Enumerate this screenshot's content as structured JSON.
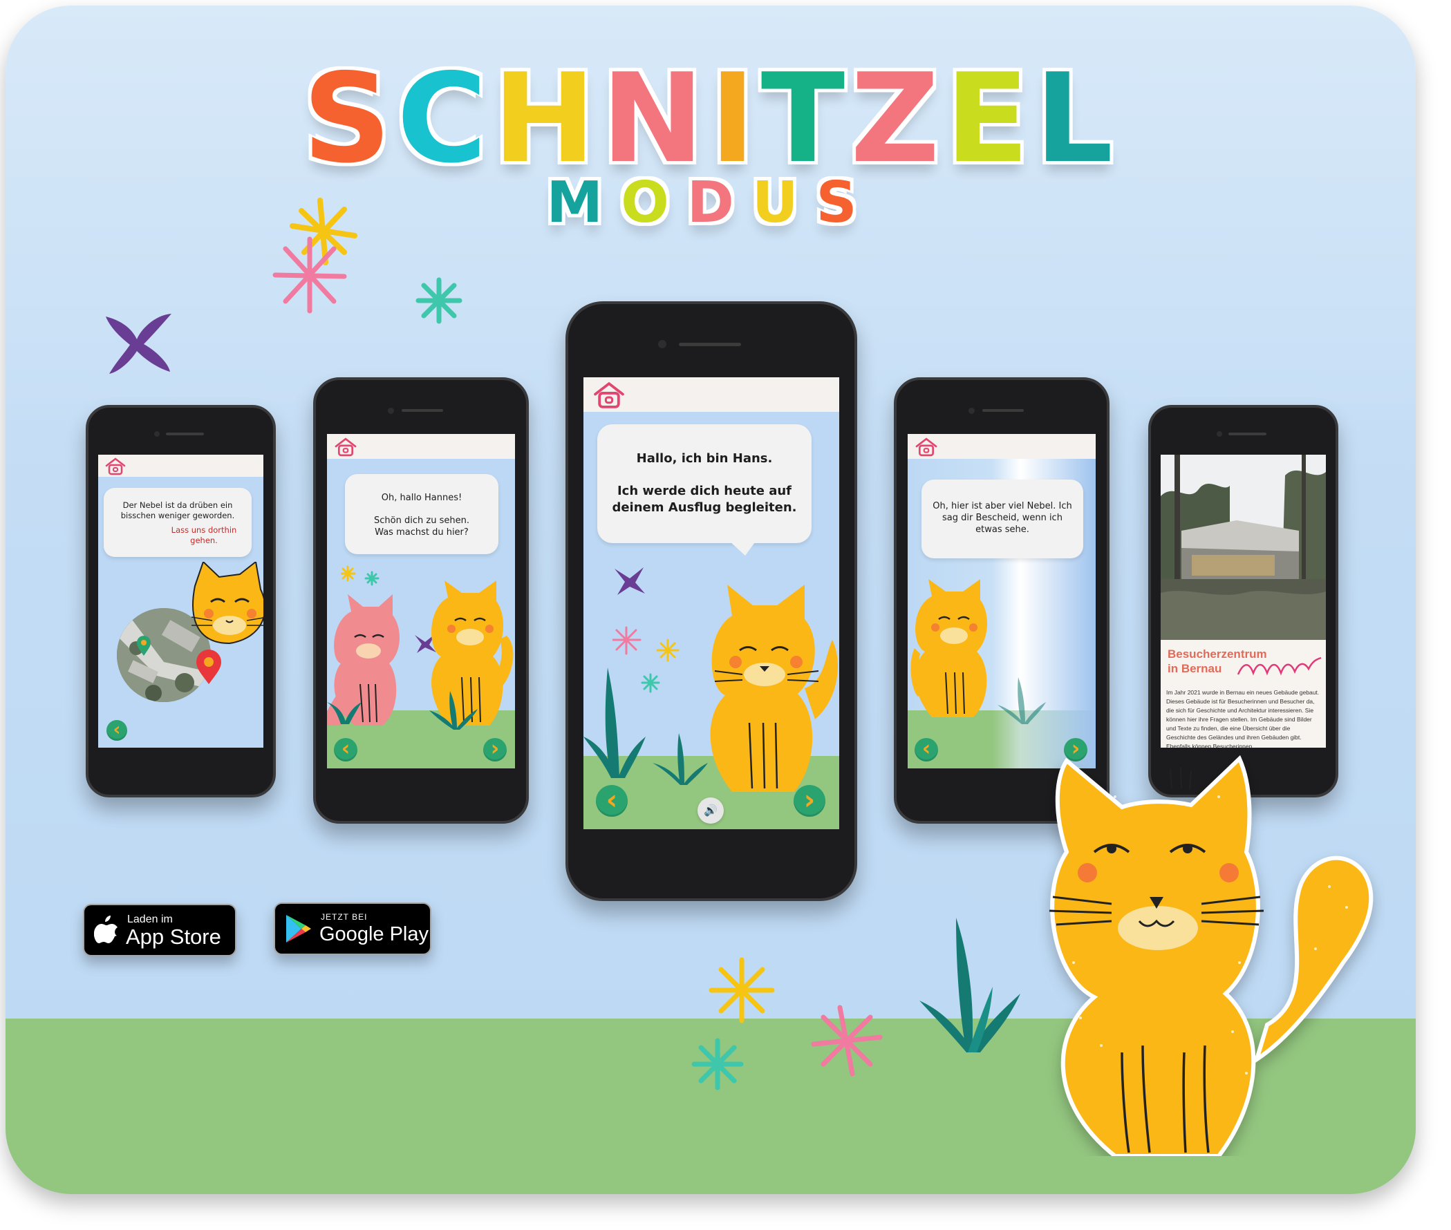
{
  "logo": {
    "title_letters": [
      {
        "ch": "S",
        "color": "#f5612f"
      },
      {
        "ch": "C",
        "color": "#18c3cf"
      },
      {
        "ch": "H",
        "color": "#f2cf1f"
      },
      {
        "ch": "N",
        "color": "#f3767f"
      },
      {
        "ch": "I",
        "color": "#f4a81f"
      },
      {
        "ch": "T",
        "color": "#16b287"
      },
      {
        "ch": "Z",
        "color": "#f3767f"
      },
      {
        "ch": "E",
        "color": "#c9dd1e"
      },
      {
        "ch": "L",
        "color": "#16a39e"
      }
    ],
    "subtitle_letters": [
      {
        "ch": "M",
        "color": "#16a39e"
      },
      {
        "ch": "O",
        "color": "#c9dd1e"
      },
      {
        "ch": "D",
        "color": "#f3767f"
      },
      {
        "ch": "U",
        "color": "#f2cf1f"
      },
      {
        "ch": "S",
        "color": "#f5612f"
      }
    ]
  },
  "phones": {
    "p1": {
      "bubble_text": "Der Nebel ist da drüben ein bisschen weniger geworden.",
      "bubble_link": "Lass uns dorthin gehen.",
      "icons": [
        "home-icon",
        "back-arrow-icon",
        "map-pin-icon"
      ]
    },
    "p2": {
      "bubble_line1": "Oh, hallo Hannes!",
      "bubble_line2": "Schön dich zu sehen. Was machst du hier?"
    },
    "p3": {
      "bubble_line1": "Hallo, ich bin Hans.",
      "bubble_line2": "Ich werde dich heute auf deinem Ausflug begleiten."
    },
    "p4": {
      "bubble_text": "Oh, hier ist aber viel Nebel. Ich sag dir Bescheid, wenn ich etwas sehe."
    },
    "p5": {
      "article_title_1": "Besucherzentrum",
      "article_title_2": "in Bernau",
      "article_body": "Im Jahr 2021 wurde in Bernau ein neues Gebäude gebaut. Dieses Gebäude ist für Besucherinnen und Besucher da, die sich für Geschichte und Architektur interessieren. Sie können hier ihre Fragen stellen. Im Gebäude sind Bilder und Texte zu finden, die eine Übersicht über die Geschichte des Geländes und ihren Gebäuden gibt. Ebenfalls können Besucherinnen"
    }
  },
  "nav": {
    "back_glyph": "‹",
    "next_glyph": "›",
    "sound_glyph": "🔊"
  },
  "stores": {
    "apple": {
      "small": "Laden im",
      "big": "App Store",
      "icon": "apple-icon"
    },
    "google": {
      "small": "JETZT BEI",
      "big": "Google Play",
      "icon": "google-play-icon"
    }
  },
  "colors": {
    "sky": "#bcd8f4",
    "grass": "#93c67f",
    "cat": "#fbb716",
    "cat_pink": "#f08b8f",
    "nav_green": "#2aa36f",
    "nav_arrow": "#f4a81f",
    "home_pink": "#e2466f"
  }
}
